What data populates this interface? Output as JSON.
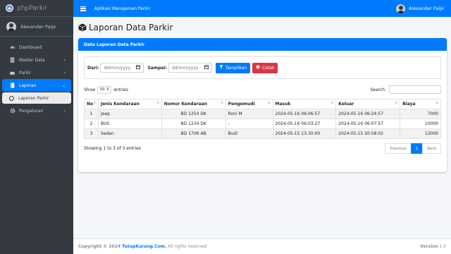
{
  "brand": {
    "name": "phpParkir"
  },
  "user": {
    "name": "Alexander Paijo"
  },
  "topbar": {
    "title": "Aplikasi Manajemen Parkir",
    "user_name": "Alexander Paijo"
  },
  "sidebar": {
    "items": [
      {
        "label": "Dashboard",
        "icon": "dashboard-icon"
      },
      {
        "label": "Master Data",
        "icon": "database-icon"
      },
      {
        "label": "Parkir",
        "icon": "car-icon"
      },
      {
        "label": "Laporan",
        "icon": "book-icon"
      },
      {
        "label": "Laporan Parkir",
        "icon": "circle-icon"
      },
      {
        "label": "Pengaturan",
        "icon": "gear-icon"
      }
    ]
  },
  "page": {
    "title": "Laporan Data Parkir"
  },
  "card": {
    "title": "Data Laporan Data Parkir"
  },
  "filter": {
    "from_label": "Dari:",
    "to_label": "Sampai:",
    "date_placeholder": "dd/mm/yyyy",
    "show_button": "Tampilkan",
    "print_button": "Cetak"
  },
  "datatable": {
    "show_label": "Show",
    "length_value": "10",
    "entries_label": "entries",
    "search_label": "Search:",
    "columns": [
      "No",
      "Jenis Kendaraan",
      "Nomor Kendaraan",
      "Pengemudi",
      "Masuk",
      "Keluar",
      "Biaya"
    ],
    "rows": [
      [
        "1",
        "Jeep",
        "BD 1254 DK",
        "Roni M",
        "2024-05-16 06:06:57",
        "2024-05-16 06:24:57",
        "7000"
      ],
      [
        "2",
        "BUS",
        "BD 1234 DK",
        "-",
        "2024-05-16 06:03:27",
        "2024-05-16 06:07:57",
        "10000"
      ],
      [
        "3",
        "Sedan",
        "BD 1706 AB",
        "Budi",
        "2024-05-15 13:30:00",
        "2024-05-15 20:58:02",
        "12000"
      ]
    ],
    "info": "Showing 1 to 3 of 3 entries",
    "pagination": {
      "previous": "Previous",
      "current": "1",
      "next": "Next"
    }
  },
  "footer": {
    "copyright_prefix": "Copyright © 2024 ",
    "copyright_link": "TutupKurung.Com.",
    "copyright_suffix": " All rights reserved.",
    "version_label": "Version",
    "version_value": "1.0"
  },
  "colors": {
    "primary": "#007bff",
    "sidebar": "#343a40",
    "danger": "#dc3545"
  }
}
